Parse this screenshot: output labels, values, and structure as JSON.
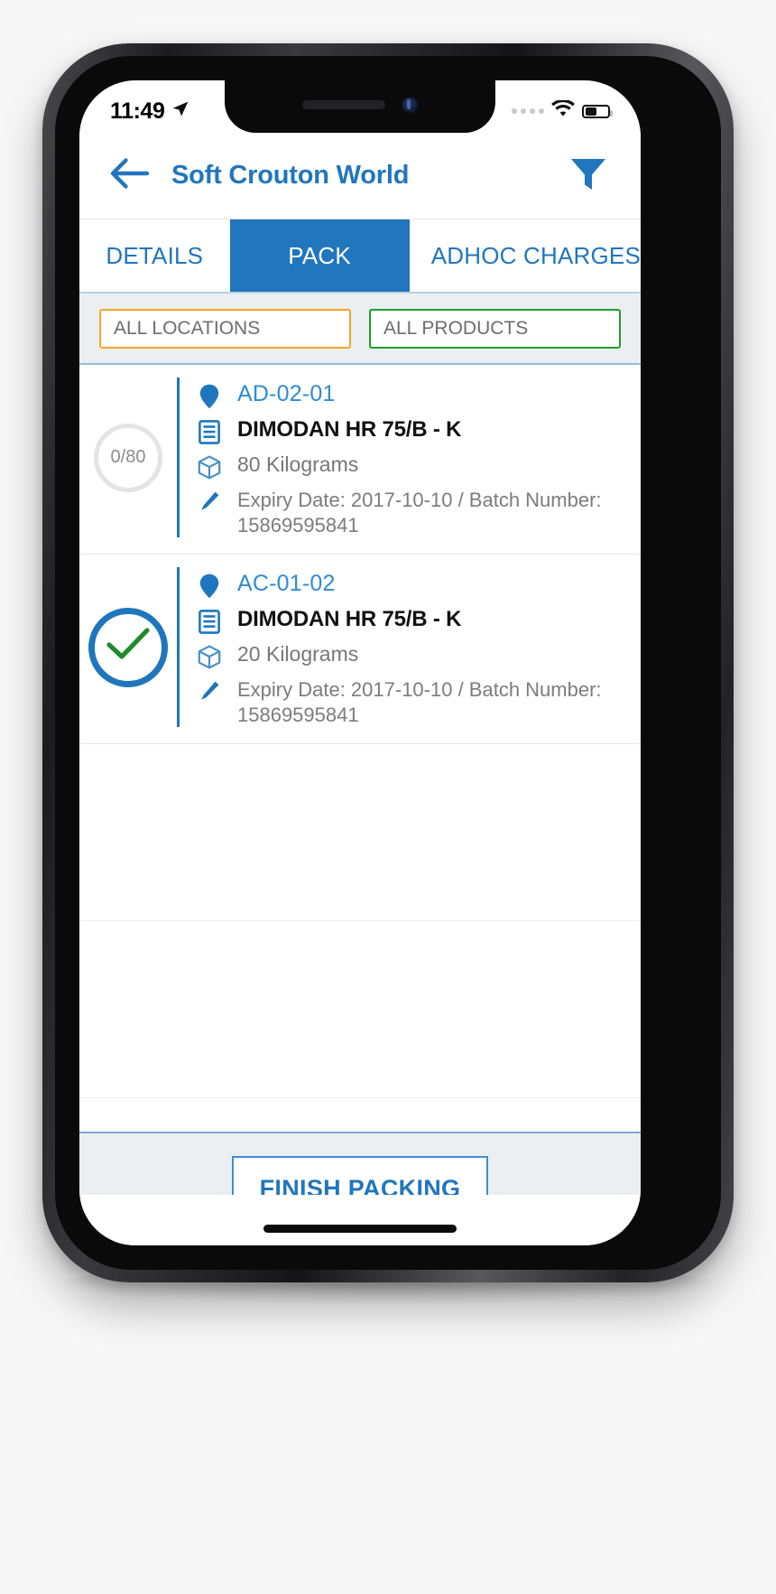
{
  "status_bar": {
    "time": "11:49",
    "location_icon": "location-arrow-icon",
    "signal_icon": "signal-dots-icon",
    "wifi_icon": "wifi-icon",
    "battery_icon": "battery-icon",
    "battery_level_pct": 45
  },
  "header": {
    "back_icon": "back-arrow-icon",
    "title": "Soft Crouton World",
    "filter_icon": "filter-funnel-icon",
    "accent_color": "#2176bd"
  },
  "tabs": [
    {
      "label": "DETAILS",
      "active": false
    },
    {
      "label": "PACK",
      "active": true
    },
    {
      "label": "ADHOC CHARGES",
      "active": false
    }
  ],
  "filters": [
    {
      "label": "ALL LOCATIONS",
      "border_color": "#f5a623"
    },
    {
      "label": "ALL PRODUCTS",
      "border_color": "#1f9d2b"
    }
  ],
  "list": {
    "items": [
      {
        "status": "0/80",
        "status_state": "pending",
        "location": "AD-02-01",
        "product": "DIMODAN HR 75/B - K",
        "quantity": "80 Kilograms",
        "meta": "Expiry Date: 2017-10-10 / Batch Number: 15869595841",
        "location_icon": "map-pin-icon",
        "product_icon": "document-lines-icon",
        "quantity_icon": "package-box-icon",
        "meta_icon": "pencil-edit-icon"
      },
      {
        "status": "",
        "status_state": "complete",
        "location": "AC-01-02",
        "product": "DIMODAN HR 75/B - K",
        "quantity": "20 Kilograms",
        "meta": "Expiry Date: 2017-10-10 / Batch Number: 15869595841",
        "location_icon": "map-pin-icon",
        "product_icon": "document-lines-icon",
        "quantity_icon": "package-box-icon",
        "meta_icon": "pencil-edit-icon",
        "check_icon": "green-check-icon"
      }
    ]
  },
  "footer": {
    "finish_packing_label": "FINISH PACKING"
  },
  "colors": {
    "primary_blue": "#2176bd",
    "tab_active_bg": "#2176bd",
    "check_green": "#1f8a2a",
    "location_orange": "#f5a623",
    "product_green": "#1f9d2b",
    "chrome_grey": "#eceff1"
  }
}
